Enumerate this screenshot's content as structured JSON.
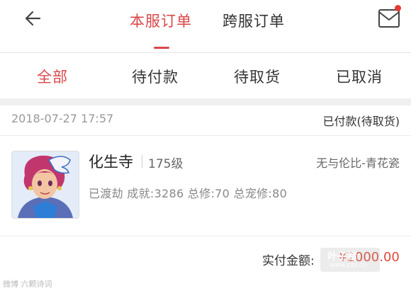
{
  "header": {
    "tabs": [
      {
        "label": "本服订单",
        "active": true
      },
      {
        "label": "跨服订单",
        "active": false
      }
    ]
  },
  "filters": [
    {
      "label": "全部",
      "active": true
    },
    {
      "label": "待付款",
      "active": false
    },
    {
      "label": "待取货",
      "active": false
    },
    {
      "label": "已取消",
      "active": false
    }
  ],
  "order": {
    "time": "2018-07-27 17:57",
    "status": "已付款(待取货)",
    "character": {
      "name": "化生寺",
      "level": "175级",
      "server": "无与伦比-青花瓷",
      "stats": "已渡劫 成就:3286 总修:70 总宠修:80"
    },
    "paid_label": "实付金额:",
    "paid_amount": "¥2000.00"
  },
  "watermark": {
    "left": "微博 六颗诗词",
    "right": "叶子猪",
    "url": "www.yzz.cn"
  },
  "colors": {
    "accent": "#d8484a",
    "price": "#e0493b",
    "notification_dot": "#e53935"
  }
}
